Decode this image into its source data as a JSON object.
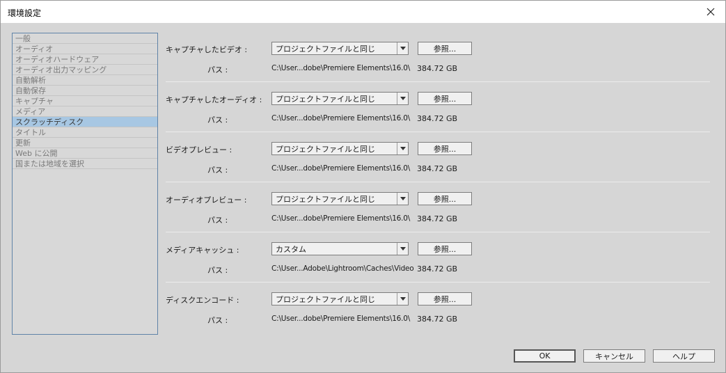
{
  "window": {
    "title": "環境設定"
  },
  "sidebar": {
    "items": [
      {
        "label": "一般"
      },
      {
        "label": "オーディオ"
      },
      {
        "label": "オーディオハードウェア"
      },
      {
        "label": "オーディオ出力マッピング"
      },
      {
        "label": "自動解析"
      },
      {
        "label": "自動保存"
      },
      {
        "label": "キャプチャ"
      },
      {
        "label": "メディア"
      },
      {
        "label": "スクラッチディスク",
        "active": true
      },
      {
        "label": "タイトル"
      },
      {
        "label": "更新"
      },
      {
        "label": "Web に公開"
      },
      {
        "label": "国または地域を選択"
      }
    ]
  },
  "settings": [
    {
      "label": "キャプチャしたビデオ :",
      "select": "プロジェクトファイルと同じ",
      "browse": "参照...",
      "path_label": "パス :",
      "path": "C:\\User...dobe\\Premiere Elements\\16.0\\",
      "size": "384.72 GB"
    },
    {
      "label": "キャプチャしたオーディオ :",
      "select": "プロジェクトファイルと同じ",
      "browse": "参照...",
      "path_label": "パス :",
      "path": "C:\\User...dobe\\Premiere Elements\\16.0\\",
      "size": "384.72 GB"
    },
    {
      "label": "ビデオプレビュー :",
      "select": "プロジェクトファイルと同じ",
      "browse": "参照...",
      "path_label": "パス :",
      "path": "C:\\User...dobe\\Premiere Elements\\16.0\\",
      "size": "384.72 GB"
    },
    {
      "label": "オーディオプレビュー :",
      "select": "プロジェクトファイルと同じ",
      "browse": "参照...",
      "path_label": "パス :",
      "path": "C:\\User...dobe\\Premiere Elements\\16.0\\",
      "size": "384.72 GB"
    },
    {
      "label": "メディアキャッシュ :",
      "select": "カスタム",
      "browse": "参照...",
      "path_label": "パス :",
      "path": "C:\\User...Adobe\\Lightroom\\Caches\\Video",
      "size": "384.72 GB"
    },
    {
      "label": "ディスクエンコード :",
      "select": "プロジェクトファイルと同じ",
      "browse": "参照...",
      "path_label": "パス :",
      "path": "C:\\User...dobe\\Premiere Elements\\16.0\\",
      "size": "384.72 GB"
    }
  ],
  "footer": {
    "ok": "OK",
    "cancel": "キャンセル",
    "help": "ヘルプ"
  }
}
